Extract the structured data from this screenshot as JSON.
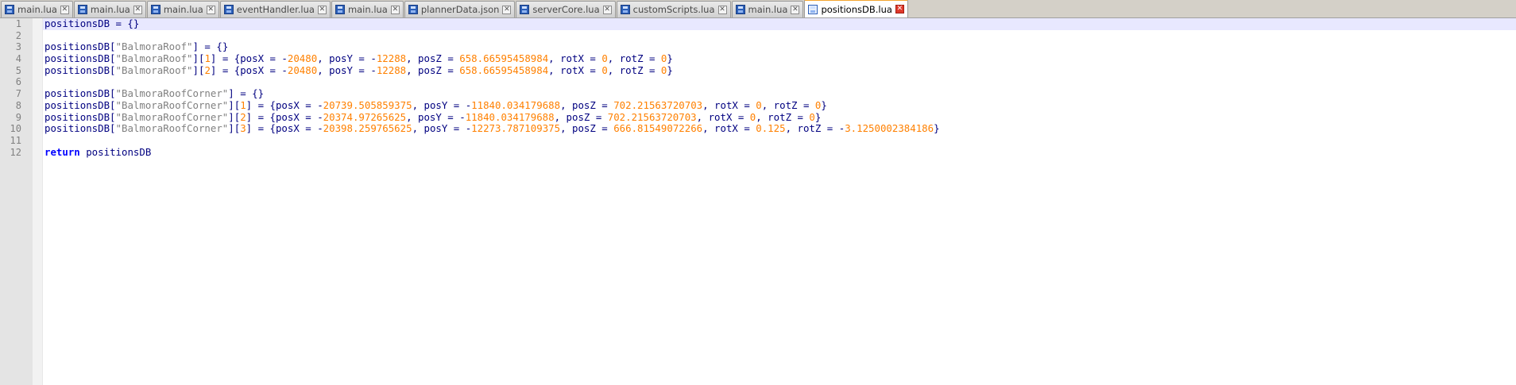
{
  "tabs": [
    {
      "label": "main.lua",
      "active": false
    },
    {
      "label": "main.lua",
      "active": false
    },
    {
      "label": "main.lua",
      "active": false
    },
    {
      "label": "eventHandler.lua",
      "active": false
    },
    {
      "label": "main.lua",
      "active": false
    },
    {
      "label": "plannerData.json",
      "active": false
    },
    {
      "label": "serverCore.lua",
      "active": false
    },
    {
      "label": "customScripts.lua",
      "active": false
    },
    {
      "label": "main.lua",
      "active": false
    },
    {
      "label": "positionsDB.lua",
      "active": true
    }
  ],
  "close_glyph": "✕",
  "editor": {
    "current_line": 1,
    "lines": [
      {
        "num": "1",
        "tokens": [
          {
            "t": "positionsDB = {}",
            "c": "plain"
          }
        ]
      },
      {
        "num": "2",
        "tokens": []
      },
      {
        "num": "3",
        "tokens": [
          {
            "t": "positionsDB[",
            "c": "plain"
          },
          {
            "t": "\"BalmoraRoof\"",
            "c": "str"
          },
          {
            "t": "] = {}",
            "c": "plain"
          }
        ]
      },
      {
        "num": "4",
        "tokens": [
          {
            "t": "positionsDB[",
            "c": "plain"
          },
          {
            "t": "\"BalmoraRoof\"",
            "c": "str"
          },
          {
            "t": "][",
            "c": "plain"
          },
          {
            "t": "1",
            "c": "num"
          },
          {
            "t": "] = {posX = -",
            "c": "plain"
          },
          {
            "t": "20480",
            "c": "num"
          },
          {
            "t": ", posY = -",
            "c": "plain"
          },
          {
            "t": "12288",
            "c": "num"
          },
          {
            "t": ", posZ = ",
            "c": "plain"
          },
          {
            "t": "658.66595458984",
            "c": "num"
          },
          {
            "t": ", rotX = ",
            "c": "plain"
          },
          {
            "t": "0",
            "c": "num"
          },
          {
            "t": ", rotZ = ",
            "c": "plain"
          },
          {
            "t": "0",
            "c": "num"
          },
          {
            "t": "}",
            "c": "plain"
          }
        ]
      },
      {
        "num": "5",
        "tokens": [
          {
            "t": "positionsDB[",
            "c": "plain"
          },
          {
            "t": "\"BalmoraRoof\"",
            "c": "str"
          },
          {
            "t": "][",
            "c": "plain"
          },
          {
            "t": "2",
            "c": "num"
          },
          {
            "t": "] = {posX = -",
            "c": "plain"
          },
          {
            "t": "20480",
            "c": "num"
          },
          {
            "t": ", posY = -",
            "c": "plain"
          },
          {
            "t": "12288",
            "c": "num"
          },
          {
            "t": ", posZ = ",
            "c": "plain"
          },
          {
            "t": "658.66595458984",
            "c": "num"
          },
          {
            "t": ", rotX = ",
            "c": "plain"
          },
          {
            "t": "0",
            "c": "num"
          },
          {
            "t": ", rotZ = ",
            "c": "plain"
          },
          {
            "t": "0",
            "c": "num"
          },
          {
            "t": "}",
            "c": "plain"
          }
        ]
      },
      {
        "num": "6",
        "tokens": []
      },
      {
        "num": "7",
        "tokens": [
          {
            "t": "positionsDB[",
            "c": "plain"
          },
          {
            "t": "\"BalmoraRoofCorner\"",
            "c": "str"
          },
          {
            "t": "] = {}",
            "c": "plain"
          }
        ]
      },
      {
        "num": "8",
        "tokens": [
          {
            "t": "positionsDB[",
            "c": "plain"
          },
          {
            "t": "\"BalmoraRoofCorner\"",
            "c": "str"
          },
          {
            "t": "][",
            "c": "plain"
          },
          {
            "t": "1",
            "c": "num"
          },
          {
            "t": "] = {posX = -",
            "c": "plain"
          },
          {
            "t": "20739.505859375",
            "c": "num"
          },
          {
            "t": ", posY = -",
            "c": "plain"
          },
          {
            "t": "11840.034179688",
            "c": "num"
          },
          {
            "t": ", posZ = ",
            "c": "plain"
          },
          {
            "t": "702.21563720703",
            "c": "num"
          },
          {
            "t": ", rotX = ",
            "c": "plain"
          },
          {
            "t": "0",
            "c": "num"
          },
          {
            "t": ", rotZ = ",
            "c": "plain"
          },
          {
            "t": "0",
            "c": "num"
          },
          {
            "t": "}",
            "c": "plain"
          }
        ]
      },
      {
        "num": "9",
        "tokens": [
          {
            "t": "positionsDB[",
            "c": "plain"
          },
          {
            "t": "\"BalmoraRoofCorner\"",
            "c": "str"
          },
          {
            "t": "][",
            "c": "plain"
          },
          {
            "t": "2",
            "c": "num"
          },
          {
            "t": "] = {posX = -",
            "c": "plain"
          },
          {
            "t": "20374.97265625",
            "c": "num"
          },
          {
            "t": ", posY = -",
            "c": "plain"
          },
          {
            "t": "11840.034179688",
            "c": "num"
          },
          {
            "t": ", posZ = ",
            "c": "plain"
          },
          {
            "t": "702.21563720703",
            "c": "num"
          },
          {
            "t": ", rotX = ",
            "c": "plain"
          },
          {
            "t": "0",
            "c": "num"
          },
          {
            "t": ", rotZ = ",
            "c": "plain"
          },
          {
            "t": "0",
            "c": "num"
          },
          {
            "t": "}",
            "c": "plain"
          }
        ]
      },
      {
        "num": "10",
        "tokens": [
          {
            "t": "positionsDB[",
            "c": "plain"
          },
          {
            "t": "\"BalmoraRoofCorner\"",
            "c": "str"
          },
          {
            "t": "][",
            "c": "plain"
          },
          {
            "t": "3",
            "c": "num"
          },
          {
            "t": "] = {posX = -",
            "c": "plain"
          },
          {
            "t": "20398.259765625",
            "c": "num"
          },
          {
            "t": ", posY = -",
            "c": "plain"
          },
          {
            "t": "12273.787109375",
            "c": "num"
          },
          {
            "t": ", posZ = ",
            "c": "plain"
          },
          {
            "t": "666.81549072266",
            "c": "num"
          },
          {
            "t": ", rotX = ",
            "c": "plain"
          },
          {
            "t": "0.125",
            "c": "num"
          },
          {
            "t": ", rotZ = -",
            "c": "plain"
          },
          {
            "t": "3.1250002384186",
            "c": "num"
          },
          {
            "t": "}",
            "c": "plain"
          }
        ]
      },
      {
        "num": "11",
        "tokens": []
      },
      {
        "num": "12",
        "tokens": [
          {
            "t": "return",
            "c": "kw"
          },
          {
            "t": " positionsDB",
            "c": "plain"
          }
        ]
      }
    ]
  },
  "colors": {
    "plain": "#000080",
    "string": "#808080",
    "number": "#ff8000",
    "keyword": "#0000ff",
    "current_line_bg": "#e8e8ff",
    "active_tab_accent": "#f4a630"
  }
}
